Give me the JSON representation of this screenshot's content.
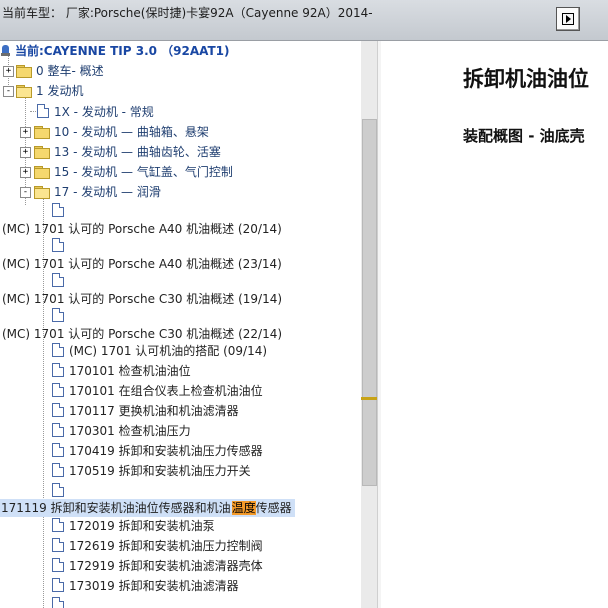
{
  "titlebar": {
    "title": "当前车型：  厂家:Porsche(保时捷)卡宴92A（Cayenne 92A）2014-"
  },
  "root": {
    "label": "当前:CAYENNE TIP 3.0 （92AAT1)"
  },
  "tree": [
    {
      "label": "0 整车- 概述"
    },
    {
      "label": "1 发动机"
    },
    {
      "label": "1X - 发动机 - 常规"
    },
    {
      "label": "10 - 发动机 — 曲轴箱、悬架"
    },
    {
      "label": "13 - 发动机 — 曲轴齿轮、活塞"
    },
    {
      "label": "15 - 发动机 — 气缸盖、气门控制"
    },
    {
      "label": "17 - 发动机 — 润滑"
    },
    {
      "label": "(MC) 1701 认可的 Porsche A40 机油概述 (20/14)"
    },
    {
      "label": "(MC) 1701 认可的 Porsche A40 机油概述 (23/14)"
    },
    {
      "label": "(MC) 1701 认可的 Porsche C30 机油概述 (19/14)"
    },
    {
      "label": "(MC) 1701 认可的 Porsche C30 机油概述 (22/14)"
    },
    {
      "label": "(MC) 1701 认可机油的搭配 (09/14)"
    },
    {
      "label": "170101 检查机油油位"
    },
    {
      "label": "170101 在组合仪表上检查机油油位"
    },
    {
      "label": "170117 更换机油和机油滤清器"
    },
    {
      "label": "170301 检查机油压力"
    },
    {
      "label": "170419 拆卸和安装机油压力传感器"
    },
    {
      "label": "170519 拆卸和安装机油压力开关"
    },
    {
      "label_pre": "171119 拆卸和安装机油油位传感器和机油",
      "label_hl": "温度",
      "label_post": "传感器"
    },
    {
      "label": "172019 拆卸和安装机油泵"
    },
    {
      "label": "172619 拆卸和安装机油压力控制阀"
    },
    {
      "label": "172919 拆卸和安装机油滤清器壳体"
    },
    {
      "label": "173019 拆卸和安装机油滤清器"
    }
  ],
  "doc": {
    "title": "拆卸机油油位",
    "subtitle": "装配概图 - 油底壳"
  },
  "colors": {
    "selection": "#cfe0f7",
    "highlight": "#f39a2a",
    "link": "#1f3e70"
  }
}
